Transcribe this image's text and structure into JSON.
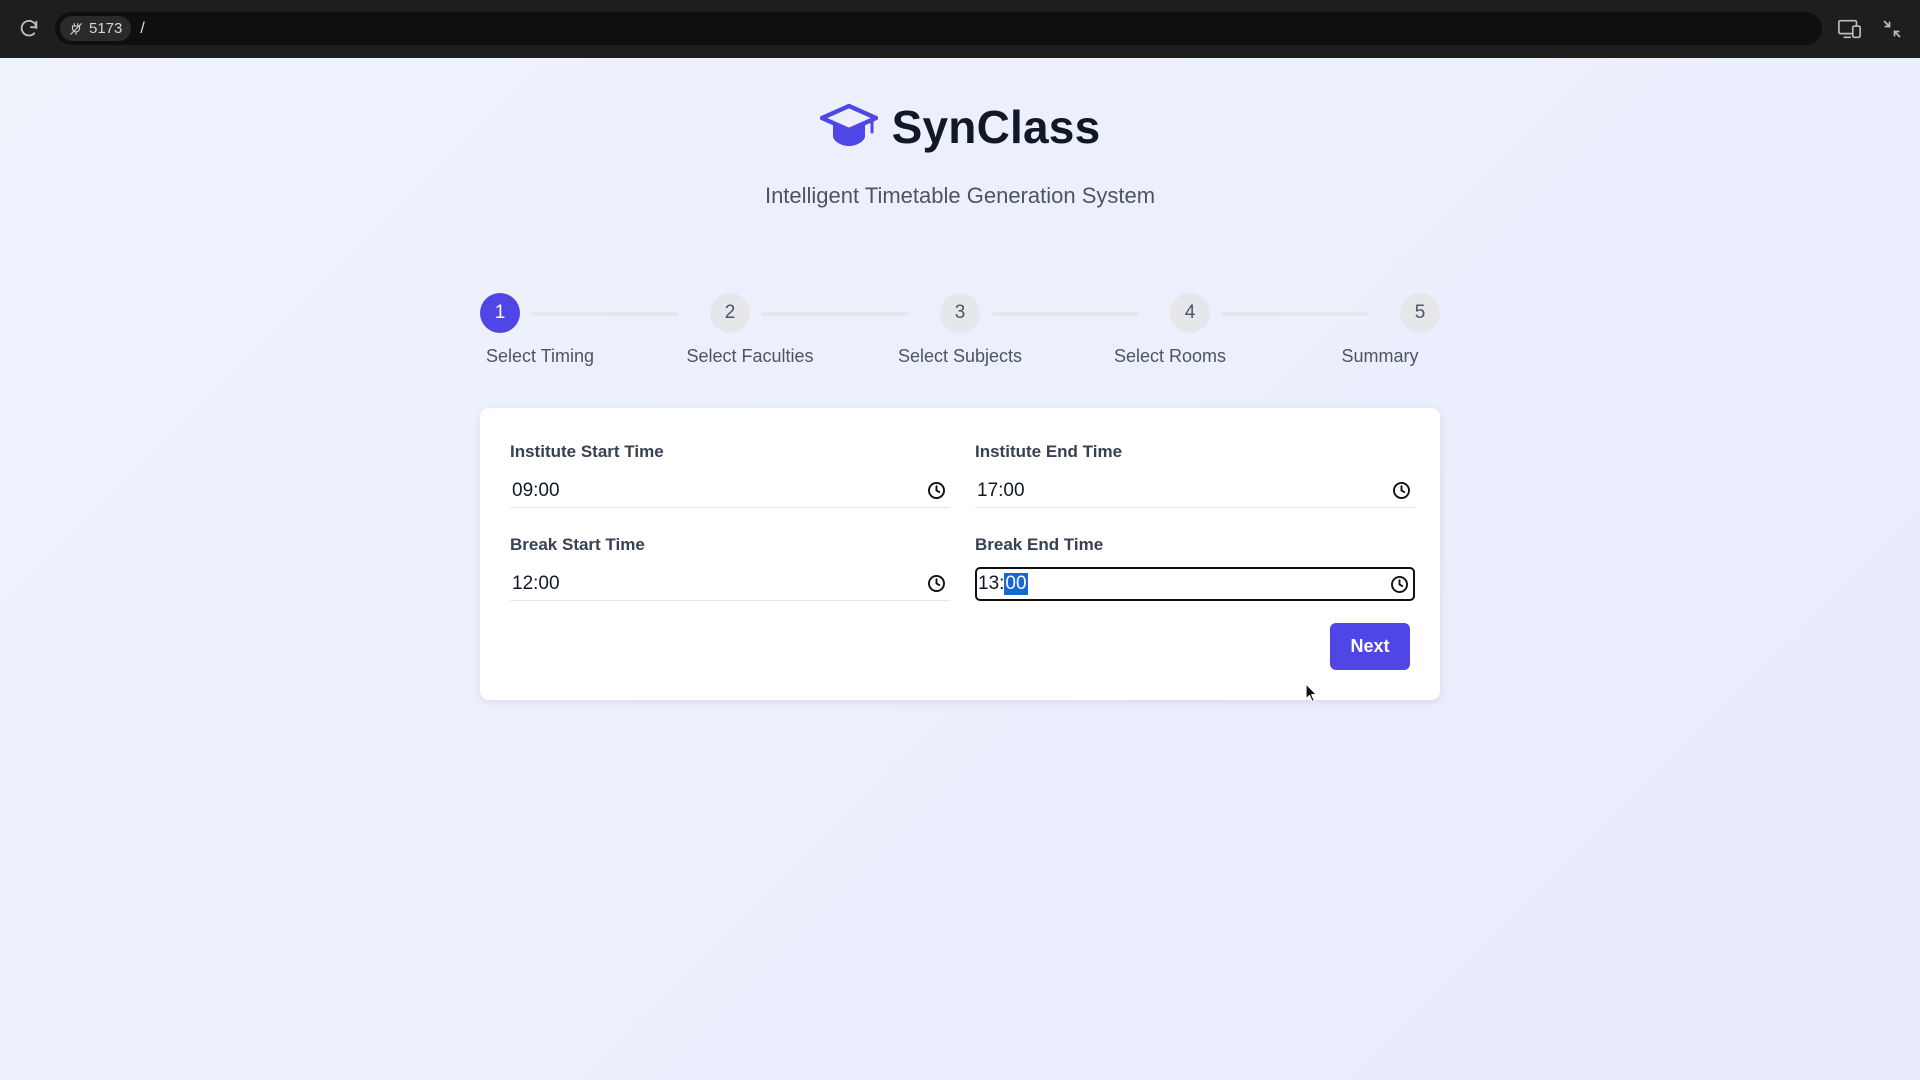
{
  "browser": {
    "port": "5173",
    "path": "/"
  },
  "header": {
    "title": "SynClass",
    "subtitle": "Intelligent Timetable Generation System",
    "accent_color": "#4f46e5"
  },
  "stepper": {
    "current_step": 1,
    "steps": [
      {
        "number": "1",
        "label": "Select Timing"
      },
      {
        "number": "2",
        "label": "Select Faculties"
      },
      {
        "number": "3",
        "label": "Select Subjects"
      },
      {
        "number": "4",
        "label": "Select Rooms"
      },
      {
        "number": "5",
        "label": "Summary"
      }
    ]
  },
  "form": {
    "institute_start": {
      "label": "Institute Start Time",
      "value": "09:00"
    },
    "institute_end": {
      "label": "Institute End Time",
      "value": "17:00"
    },
    "break_start": {
      "label": "Break Start Time",
      "value": "12:00"
    },
    "break_end": {
      "label": "Break End Time",
      "hours": "13",
      "separator": ":",
      "minutes": "00"
    },
    "next_label": "Next"
  },
  "icons": {
    "reload": "reload-icon",
    "port": "disconnected-plug-icon",
    "devices": "devices-icon",
    "collapse": "collapse-icon",
    "logo": "graduation-cap-icon",
    "clock": "clock-icon"
  }
}
